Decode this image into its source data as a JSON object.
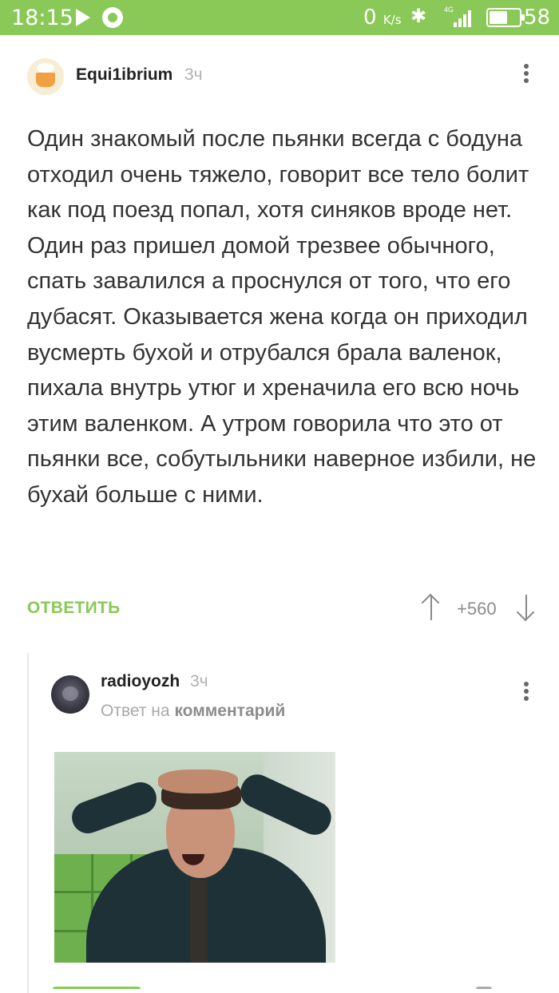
{
  "status_bar": {
    "time": "18:15",
    "net_speed": "0",
    "net_speed_unit": "K/s",
    "network_type": "4G",
    "battery_percent": "58",
    "background_color": "#8ac858"
  },
  "comments": [
    {
      "author": "Equi1ibrium",
      "time": "3ч",
      "text": "Один знакомый после пьянки всегда с бодуна отходил очень тяжело, говорит все тело болит как под поезд попал, хотя синяков вроде нет. Один раз пришел домой трезвее обычного, спать завалился а проснулся от того, что его дубасят. Оказывается жена когда он приходил вусмерть бухой и отрубался брала валенок, пихала внутрь утюг и хреначила его всю ночь этим валенком. А утром говорила что это от пьянки все, собутыльники наверное избили, не бухай больше с ними.",
      "reply_label": "ОТВЕТИТЬ",
      "rating": "+560"
    },
    {
      "author": "radioyozh",
      "time": "3ч",
      "reply_prefix": "Ответ на",
      "reply_target": "комментарий"
    }
  ],
  "colors": {
    "accent": "#8ac858",
    "text": "#333333",
    "muted": "#b0b0b0"
  },
  "icons": {
    "play": "play-icon",
    "whatsapp": "whatsapp-icon",
    "bluetooth": "bluetooth-icon",
    "signal": "signal-icon",
    "battery": "battery-icon",
    "more": "more-vertical-icon",
    "upvote": "arrow-up-icon",
    "downvote": "arrow-down-icon"
  }
}
